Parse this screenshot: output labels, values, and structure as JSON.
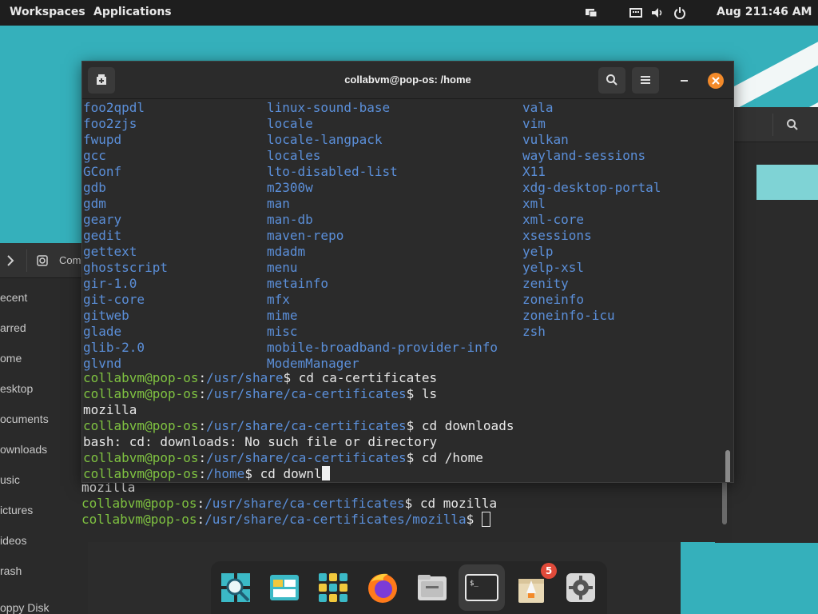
{
  "top_bar": {
    "workspaces_label": "Workspaces",
    "applications_label": "Applications",
    "date": "Aug 21",
    "time": "1:46 AM"
  },
  "terminal": {
    "title": "collabvm@pop-os: /home",
    "columns": [
      [
        "foo2qpdl",
        "foo2zjs",
        "fwupd",
        "gcc",
        "GConf",
        "gdb",
        "gdm",
        "geary",
        "gedit",
        "gettext",
        "ghostscript",
        "gir-1.0",
        "git-core",
        "gitweb",
        "glade",
        "glib-2.0",
        "glvnd"
      ],
      [
        "linux-sound-base",
        "locale",
        "locale-langpack",
        "locales",
        "lto-disabled-list",
        "m2300w",
        "man",
        "man-db",
        "maven-repo",
        "mdadm",
        "menu",
        "metainfo",
        "mfx",
        "mime",
        "misc",
        "mobile-broadband-provider-info",
        "ModemManager"
      ],
      [
        "vala",
        "vim",
        "vulkan",
        "wayland-sessions",
        "X11",
        "xdg-desktop-portal",
        "xml",
        "xml-core",
        "xsessions",
        "yelp",
        "yelp-xsl",
        "zenity",
        "zoneinfo",
        "zoneinfo-icu",
        "zsh"
      ]
    ],
    "lines": [
      {
        "user": "collabvm@pop-os",
        "sep": ":",
        "path": "/usr/share",
        "cmd": "$ cd ca-certificates"
      },
      {
        "user": "collabvm@pop-os",
        "sep": ":",
        "path": "/usr/share/ca-certificates",
        "cmd": "$ ls"
      },
      {
        "dir": "mozilla"
      },
      {
        "user": "collabvm@pop-os",
        "sep": ":",
        "path": "/usr/share/ca-certificates",
        "cmd": "$ cd downloads"
      },
      {
        "text": "bash: cd: downloads: No such file or directory"
      },
      {
        "user": "collabvm@pop-os",
        "sep": ":",
        "path": "/usr/share/ca-certificates",
        "cmd": "$ cd /home"
      },
      {
        "user": "collabvm@pop-os",
        "sep": ":",
        "path": "/home",
        "cmd": "$ cd downl"
      }
    ]
  },
  "background_terminal": {
    "lines": [
      {
        "dir": "mozilla"
      },
      {
        "user": "collabvm@pop-os",
        "sep": ":",
        "path": "/usr/share/ca-certificates",
        "cmd": "$ cd mozilla"
      },
      {
        "user": "collabvm@pop-os",
        "sep": ":",
        "path": "/usr/share/ca-certificates/mozilla",
        "cmd": "$ "
      }
    ]
  },
  "files_window": {
    "toolbar_label": "Comp",
    "sidebar": [
      "ecent",
      "arred",
      "ome",
      "esktop",
      "ocuments",
      "ownloads",
      "usic",
      "ictures",
      "ideos",
      "rash",
      "oppy Disk"
    ]
  },
  "dock": {
    "items": [
      "search-icon",
      "files-app-icon",
      "apps-grid-icon",
      "firefox-icon",
      "file-manager-icon",
      "terminal-icon",
      "pop-shop-icon",
      "settings-icon"
    ],
    "shop_badge": "5"
  },
  "colors": {
    "terminal_bg": "#2b2b2b",
    "user_green": "#7fc241",
    "path_blue": "#5b8fd9",
    "close_orange": "#f38a2a",
    "wallpaper_teal": "#35b0bb"
  }
}
